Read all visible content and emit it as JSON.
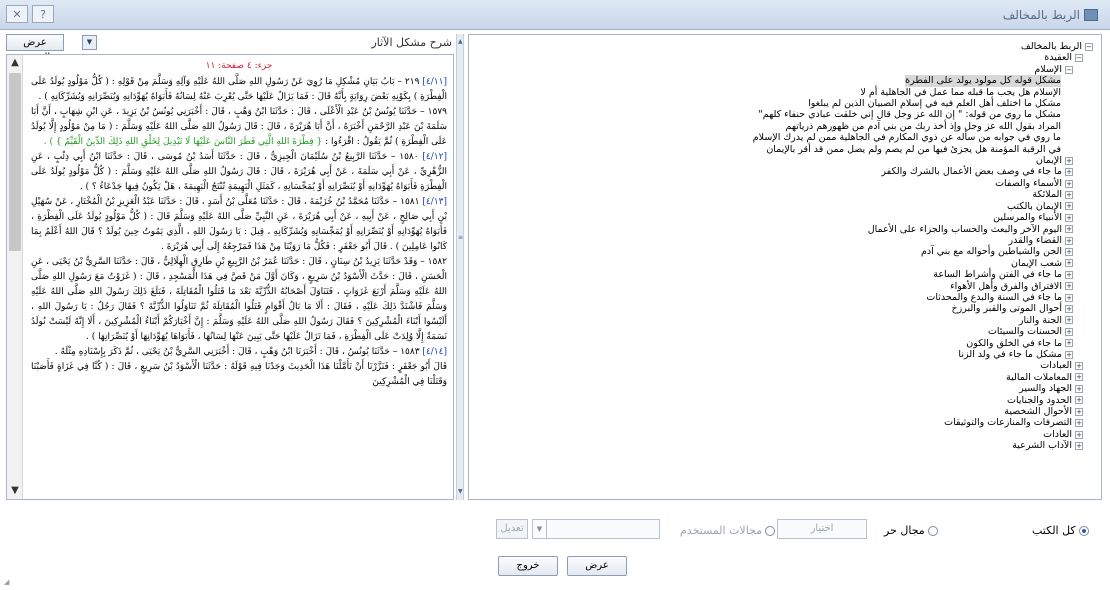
{
  "window": {
    "title": "الربط بالمخالف",
    "buttons": [
      "✕",
      "?"
    ]
  },
  "source_panel": {
    "button_label": "عرض المصدر",
    "source_title": "شرح مشكل الآثار",
    "page_heading": "جزء: ٤ صفحة: ١١",
    "paragraphs": [
      {
        "ref": "[٤/١١]",
        "text": "٢١٩ – بَابُ بَيَانِ مُشْكِلِ مَا رُوِيَ عَنْ رَسُولِ اللهِ صَلَّى اللهُ عَلَيْهِ وَآلِهِ وَسَلَّمَ مِنْ قَوْلِهِ : ( كُلُّ مَوْلُودٍ يُولَدُ عَلَى الْفِطْرَةِ ) بِكَوْنِهِ بَعْضَ رِوَايَةٍ بِأَنَّهُ قَالَ : فَمَا يَزَالُ عَلَيْهَا حَتَّى يُعْرِبَ عَنْهُ لِسَانُهُ فَأَبَوَاهُ يُهَوِّدَانِهِ وَيُنَصِّرَانِهِ وَيُشَرِّكَانِهِ ) .",
        "verse": ""
      },
      {
        "ref": "",
        "text": "١٥٧٩ – حَدَّثَنَا يُونُسُ بْنُ عَبْدِ الْأَعْلَى ، قَالَ : حَدَّثَنَا ابْنُ وَهْبٍ ، قَالَ : أَخْبَرَنِي يُونُسُ بْنُ يَزِيدَ ، عَنِ ابْنِ شِهَابٍ ، أَنَّ أَبَا سَلَمَةَ بْنَ عَبْدِ الرَّحْمَنِ أَخْبَرَهُ ، أَنَّ أَبَا هُرَيْرَةَ ، قَالَ : قَالَ رَسُولُ اللهِ صَلَّى اللهُ عَلَيْهِ وَسَلَّمَ : ( مَا مِنْ مَوْلُودٍ إِلَّا يُولَدُ عَلَى الْفِطْرَةِ ) ثُمَّ يَقُولُ : اقْرَءُوا :",
        "verse": "{ فِطْرَةَ اللهِ الَّتِي فَطَرَ النَّاسَ عَلَيْهَا لَا تَبْدِيلَ لِخَلْقِ اللهِ ذَلِكَ الدِّينُ الْقَيِّمُ } ) ."
      },
      {
        "ref": "[٤/١٢]",
        "text": "١٥٨٠ – حَدَّثَنَا الرَّبِيعُ بْنُ سُلَيْمَانَ الْجِيزِيُّ ، قَالَ : حَدَّثَنَا أَسَدُ بْنُ مُوسَى ، قَالَ : حَدَّثَنَا ابْنُ أَبِي ذِئْبٍ ، عَنِ الزُّهْرِيِّ ، عَنْ أَبِي سَلَمَةَ ، عَنْ أَبِي هُرَيْرَةَ ، قَالَ : قَالَ رَسُولُ اللهِ صَلَّى اللهُ عَلَيْهِ وَسَلَّمَ : ( كُلُّ مَوْلُودٍ يُولَدُ عَلَى الْفِطْرَةِ فَأَبَوَاهُ يُهَوِّدَانِهِ أَوْ يُنَصِّرَانِهِ أَوْ يُمَجِّسَانِهِ ، كَمَثَلِ الْبَهِيمَةِ تُنْتَجُ الْبَهِيمَةَ ، هَلْ يَكُونُ فِيهَا جَدْعَاءُ ؟ ) .",
        "verse": ""
      },
      {
        "ref": "[٤/١٣]",
        "text": "١٥٨١ – حَدَّثَنَا مُحَمَّدُ بْنُ خُزَيْمَةَ ، قَالَ : حَدَّثَنَا مُعَلَّى بْنُ أَسَدٍ ، قَالَ : حَدَّثَنَا عَبْدُ الْعَزِيزِ بْنُ الْمُخْتَارِ ، عَنْ سُهَيْلِ بْنِ أَبِي صَالِحٍ ، عَنْ أَبِيهِ ، عَنْ أَبِي هُرَيْرَةَ ، عَنِ النَّبِيِّ صَلَّى اللهُ عَلَيْهِ وَسَلَّمَ قَالَ : ( كُلُّ مَوْلُودٍ يُولَدُ عَلَى الْفِطْرَةِ ، فَأَبَوَاهُ يُهَوِّدَانِهِ أَوْ يُنَصِّرَانِهِ أَوْ يُمَجِّسَانِهِ وَيُشَرِّكَانِهِ ، قِيلَ : يَا رَسُولَ اللهِ ، الَّذِي يَمُوتُ حِينَ يُولَدُ ؟ قَالَ اللهُ أَعْلَمُ بِمَا كَانُوا عَامِلِينَ ) . قَالَ أَبُو جَعْفَرٍ : فَكُلُّ مَا رَوَيْنَا مِنْ هَذَا فَمَرْجِعُهُ إِلَى أَبِي هُرَيْرَةَ .",
        "verse": ""
      },
      {
        "ref": "",
        "text": "١٥٨٢ – وَقَدْ حَدَّثَنَا يَزِيدُ بْنُ سِنَانٍ ، قَالَ : حَدَّثَنَا عُمَرُ بْنُ الرَّبِيعِ بْنِ طَارِقٍ الْهِلَالِيُّ ، قَالَ : حَدَّثَنَا السَّرِيُّ بْنُ يَحْيَى ، عَنِ الْحَسَنِ ، قَالَ : حَدَّثَ الْأَسْوَدُ بْنُ سَرِيعٍ ، وَكَانَ أَوَّلَ مَنْ قَصَّ فِي هَذَا الْمَسْجِدِ ، قَالَ : ( غَزَوْتُ مَعَ رَسُولِ اللهِ صَلَّى اللهُ عَلَيْهِ وَسَلَّمَ أَرْبَعَ غَزَوَاتٍ ، فَتَنَاوَلَ أَصْحَابُهُ الذُّرِّيَّةَ بَعْدَ مَا قَتَلُوا الْمُقَاتِلَةَ ، فَبَلَغَ ذَلِكَ رَسُولَ اللهِ صَلَّى اللهُ عَلَيْهِ وَسَلَّمَ فَاشْتَدَّ ذَلِكَ عَلَيْهِ ، فَقَالَ : أَلَا مَا بَالُ أَقْوَامٍ قَتَلُوا الْمُقَاتِلَةَ ثُمَّ تَنَاوَلُوا الذُّرِّيَّةَ ؟ فَقَالَ رَجُلٌ : يَا رَسُولَ اللهِ ، أَلَيْسُوا أَبْنَاءَ الْمُشْرِكِينَ ؟ فَقَالَ رَسُولُ اللهِ صَلَّى اللهُ عَلَيْهِ وَسَلَّمَ : إِنَّ أَخْيَارَكُمْ أَبْنَاءُ الْمُشْرِكِينَ ، أَلَا إِنَّهُ لَيْسَتْ نُولَدُ نَسَمَةٌ إِلَّا وُلِدَتْ عَلَى الْفِطْرَةِ ، فَمَا تَزَالُ عَلَيْهَا حَتَّى يَبِينَ عَنْهَا لِسَانُهَا ، فَأَبَوَاهَا يُهَوِّدَانِهَا أَوْ يُنَصِّرَانِهَا ) .",
        "verse": ""
      },
      {
        "ref": "[٤/١٤]",
        "text": "١٥٨٣ – حَدَّثَنَا يُونُسُ ، قَالَ : أَخْبَرَنَا ابْنُ وَهْبٍ ، قَالَ : أَخْبَرَنِي السَّرِيُّ بْنُ يَحْيَى ، ثُمَّ ذَكَرَ بِإِسْنَادِهِ مِثْلَهُ .",
        "verse": ""
      },
      {
        "ref": "",
        "text": "قَالَ أَبُو جَعْفَرٍ : فَنَزَّرْنَا أَنْ تَأَمَّلْنَا هَذَا الْحَدِيثَ وَجَدْنَا فِيهِ قَوْلَهُ : حَدَّثَنَا الْأَسْوَدُ بْنُ سَرِيعٍ ، قَالَ : ( كُنَّا فِي غَزَاةٍ فَأَصَبْنَا وَقَتَلْنَا فِي الْمُشْرِكِينَ",
        "verse": ""
      }
    ]
  },
  "tree": {
    "nodes": [
      {
        "label": "الربط بالمخالف",
        "level": 0,
        "exp": "⊟"
      },
      {
        "label": "العقيدة",
        "level": 1,
        "exp": "⊟"
      },
      {
        "label": "الإسلام",
        "level": 2,
        "exp": "⊟"
      },
      {
        "label": "مشكل قوله كل مولود يولد على الفطرة",
        "level": 3,
        "exp": "",
        "selected": true
      },
      {
        "label": "الإسلام هل يجب ما قبله مما عمل في الجاهلية أم لا",
        "level": 3,
        "exp": ""
      },
      {
        "label": "مشكل ما اختلف أهل العلم فيه في إسلام الصبيان الذين لم يبلغوا",
        "level": 3,
        "exp": ""
      },
      {
        "label": "مشكل ما روي من قوله: \" إن الله عز وجل قال إني خلقت عبادي حنفاء كلهم\"",
        "level": 3,
        "exp": ""
      },
      {
        "label": "المراد بقول الله عز وجل وإذ أخذ ربك من بني آدم من ظهورهم ذرياتهم",
        "level": 3,
        "exp": ""
      },
      {
        "label": "ما روي  في جوابه من سأله عن ذوي المكارم في الجاهلية ممن لم يدرك الإسلام",
        "level": 3,
        "exp": ""
      },
      {
        "label": "في الرقبة المؤمنة هل يجزئ فيها من لم يصم ولم يصل ممن قد أقر بالإيمان",
        "level": 3,
        "exp": ""
      },
      {
        "label": "الإيمان",
        "level": 2,
        "exp": "⊞"
      },
      {
        "label": "ما جاء في وصف بعض الأعمال بالشرك والكفر",
        "level": 2,
        "exp": "⊞"
      },
      {
        "label": "الأسماء والصفات",
        "level": 2,
        "exp": "⊞"
      },
      {
        "label": "الملائكة",
        "level": 2,
        "exp": "⊞"
      },
      {
        "label": "الإيمان بالكتب",
        "level": 2,
        "exp": "⊞"
      },
      {
        "label": "الأنبياء والمرسلين",
        "level": 2,
        "exp": "⊞"
      },
      {
        "label": "اليوم الآخر والبعث والحساب والجزاء على الأعمال",
        "level": 2,
        "exp": "⊞"
      },
      {
        "label": "القضاء والقدر",
        "level": 2,
        "exp": "⊞"
      },
      {
        "label": "الجن والشياطين وأحواله مع بني آدم",
        "level": 2,
        "exp": "⊞"
      },
      {
        "label": "شعب الإيمان",
        "level": 2,
        "exp": "⊞"
      },
      {
        "label": "ما جاء في الفتن وأشراط الساعة",
        "level": 2,
        "exp": "⊞"
      },
      {
        "label": "الافتراق والفرق وأهل الأهواء",
        "level": 2,
        "exp": "⊞"
      },
      {
        "label": "ما جاء في السنة والبدع والمحدثات",
        "level": 2,
        "exp": "⊞"
      },
      {
        "label": "أحوال الموتى والقبر والبرزخ",
        "level": 2,
        "exp": "⊞"
      },
      {
        "label": "الجنة والنار",
        "level": 2,
        "exp": "⊞"
      },
      {
        "label": "الحسنات والسيئات",
        "level": 2,
        "exp": "⊞"
      },
      {
        "label": "ما جاء في الخلق والكون",
        "level": 2,
        "exp": "⊞"
      },
      {
        "label": "مشكل ما جاء في ولد الزنا",
        "level": 2,
        "exp": "⊞"
      },
      {
        "label": "العبادات",
        "level": 1,
        "exp": "⊞"
      },
      {
        "label": "المعاملات المالية",
        "level": 1,
        "exp": "⊞"
      },
      {
        "label": "الجهاد والسير",
        "level": 1,
        "exp": "⊞"
      },
      {
        "label": "الحدود والجنايات",
        "level": 1,
        "exp": "⊞"
      },
      {
        "label": "الأحوال الشخصية",
        "level": 1,
        "exp": "⊞"
      },
      {
        "label": "التصرفات والمنازعات والتوثيقات",
        "level": 1,
        "exp": "⊞"
      },
      {
        "label": "العادات",
        "level": 1,
        "exp": "⊞"
      },
      {
        "label": "الآداب الشرعية",
        "level": 1,
        "exp": "⊞"
      }
    ]
  },
  "options": {
    "all_books": "كل الكتب",
    "free_field": "مجال حر",
    "choose": "اختيار",
    "user_fields": "مجالات المستخدم",
    "edit": "تعديل",
    "selected": "all_books"
  },
  "actions": {
    "show": "عرض",
    "exit": "خروج"
  }
}
